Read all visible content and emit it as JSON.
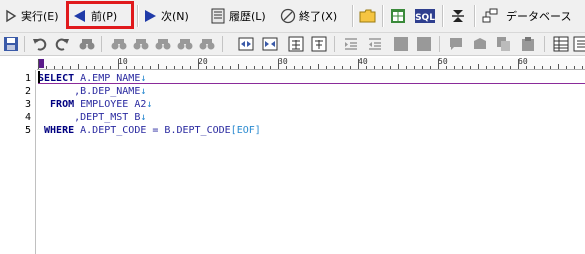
{
  "toolbar_main": {
    "run_label": "実行(E)",
    "prev_label": "前(P)",
    "next_label": "次(N)",
    "history_label": "履歴(L)",
    "exit_label": "終了(X)",
    "database_label": "データベース"
  },
  "ruler": {
    "labels": [
      "0",
      "10",
      "20",
      "30",
      "40",
      "50",
      "60"
    ]
  },
  "editor": {
    "line_numbers": [
      "1",
      "2",
      "3",
      "4",
      "5"
    ],
    "lines": [
      {
        "kw": "SELECT",
        "rest": " A.EMP_NAME",
        "mark": "↓"
      },
      {
        "kw": "",
        "rest": "      ,B.DEP_NAME",
        "mark": "↓"
      },
      {
        "kw": "  FROM",
        "rest": " EMPLOYEE A2",
        "mark": "↓"
      },
      {
        "kw": "",
        "rest": "      ,DEPT_MST B",
        "mark": "↓"
      },
      {
        "kw": " WHERE",
        "rest": " A.DEPT_CODE = B.DEPT_CODE",
        "mark": "[EOF]"
      }
    ]
  },
  "colors": {
    "highlight_box": "#e0191c",
    "keyword": "#000080",
    "identifier": "#2a2aa0",
    "line_marker": "#2a8ad0"
  }
}
